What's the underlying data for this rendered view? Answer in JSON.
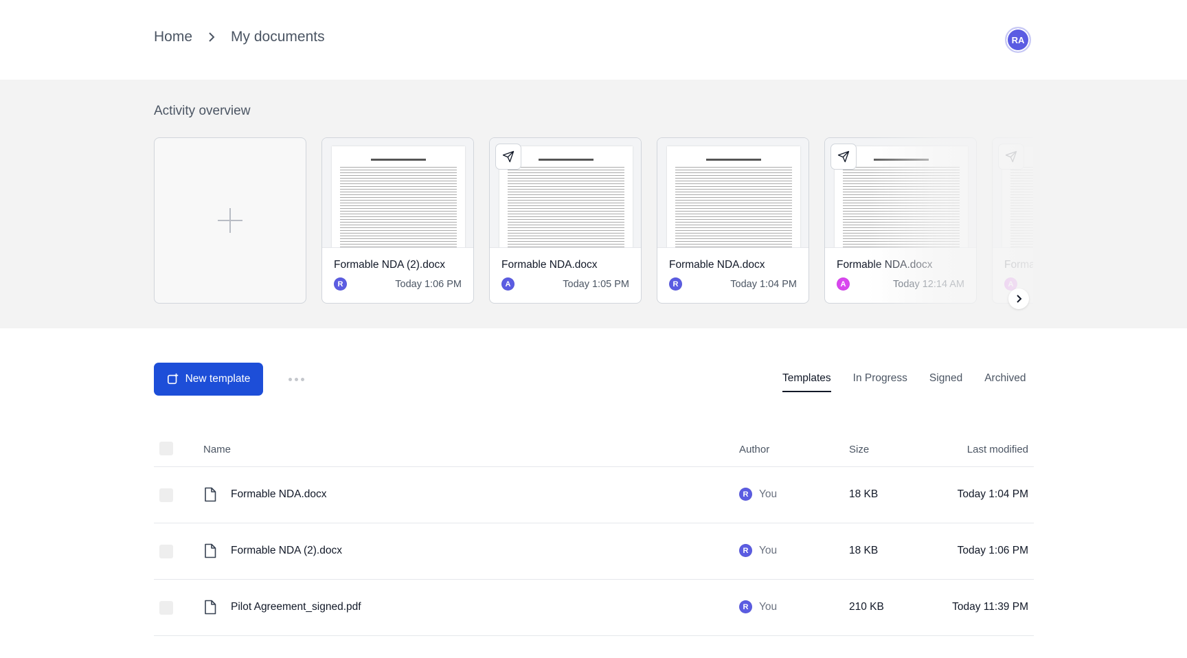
{
  "header": {
    "breadcrumb": [
      "Home",
      "My documents"
    ],
    "user_initials": "RA"
  },
  "activity": {
    "title": "Activity overview",
    "cards": [
      {
        "name": "Formable NDA (2).docx",
        "avatar": "R",
        "avatar_color": "#5b5ce2",
        "time": "Today 1:06 PM",
        "sent": false
      },
      {
        "name": "Formable NDA.docx",
        "avatar": "A",
        "avatar_color": "#5b5ce2",
        "time": "Today 1:05 PM",
        "sent": true
      },
      {
        "name": "Formable NDA.docx",
        "avatar": "R",
        "avatar_color": "#5b5ce2",
        "time": "Today 1:04 PM",
        "sent": false
      },
      {
        "name": "Formable NDA.docx",
        "avatar": "A",
        "avatar_color": "#d946ef",
        "time": "Today 12:14 AM",
        "sent": true
      },
      {
        "name": "Formable NDA.docx",
        "avatar": "A",
        "avatar_color": "#d946ef",
        "time": "",
        "sent": true
      }
    ]
  },
  "toolbar": {
    "new_template_label": "New template",
    "tabs": [
      "Templates",
      "In Progress",
      "Signed",
      "Archived"
    ],
    "active_tab": "Templates"
  },
  "table": {
    "headers": {
      "name": "Name",
      "author": "Author",
      "size": "Size",
      "modified": "Last modified"
    },
    "rows": [
      {
        "name": "Formable NDA.docx",
        "author_initial": "R",
        "author": "You",
        "size": "18 KB",
        "modified": "Today 1:04 PM"
      },
      {
        "name": "Formable NDA (2).docx",
        "author_initial": "R",
        "author": "You",
        "size": "18 KB",
        "modified": "Today 1:06 PM"
      },
      {
        "name": "Pilot Agreement_signed.pdf",
        "author_initial": "R",
        "author": "You",
        "size": "210 KB",
        "modified": "Today 11:39 PM"
      }
    ]
  },
  "colors": {
    "accent": "#1d4ed8",
    "avatar_indigo": "#5b5ce2",
    "avatar_pink": "#d946ef"
  },
  "icons": [
    "chevron-right-icon",
    "plus-icon",
    "send-icon",
    "file-icon",
    "new-template-icon",
    "more-icon"
  ]
}
